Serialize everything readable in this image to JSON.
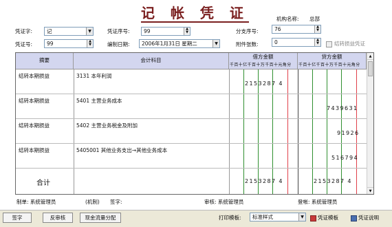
{
  "title": "记 帐 凭 证",
  "org": {
    "label": "机构名称:",
    "value": "总部"
  },
  "form": {
    "voucher_type_label": "凭证字:",
    "voucher_type": "记",
    "voucher_seq_label": "凭证序号:",
    "voucher_seq": "99",
    "branch_seq_label": "分支序号:",
    "branch_seq": "76",
    "voucher_no_label": "凭证号:",
    "voucher_no": "99",
    "date_label": "编制日期:",
    "date": "2006年1月31日 星期二",
    "attach_label": "附件张数:",
    "attach": "0",
    "carry_over_label": "结转损益凭证"
  },
  "table": {
    "col_summary": "摘要",
    "col_account": "会计科目",
    "debit_label": "借方金额",
    "credit_label": "贷方金额",
    "digit_units": "千百十亿千百十万千百十元角分",
    "rows": [
      {
        "summary": "结转本期损益",
        "account": "3131   本年利润",
        "debit": "2153287 4",
        "credit": ""
      },
      {
        "summary": "结转本期损益",
        "account": "5401   主营业务成本",
        "debit": "",
        "credit": "7439631"
      },
      {
        "summary": "结转本期损益",
        "account": "5402   主营业务税金及附加",
        "debit": "",
        "credit": "91926"
      },
      {
        "summary": "结转本期损益",
        "account": "5405001   其他业务支出→其他业务成本",
        "debit": "",
        "credit": "516794"
      }
    ],
    "total_label": "合计",
    "total_debit": "2153287 4",
    "total_credit": "2153287 4"
  },
  "footer": {
    "maker": "制单: 系统管理员",
    "maker_tag": "(机制)",
    "sign": "签字:",
    "review": "审核: 系统管理员",
    "post": "登帐: 系统管理员"
  },
  "toolbar": {
    "sign_btn": "签字",
    "unreview_btn": "反审核",
    "cashflow_btn": "现金流量分配",
    "print_label": "打印模板:",
    "print_value": "标准样式",
    "template_btn": "凭证模板",
    "help_btn": "凭证说明"
  },
  "colors": {
    "title": "#7a1f1f",
    "header_bg": "#d3d6ef",
    "green_line": "#2f8f2f",
    "red_line": "#e0404a"
  }
}
